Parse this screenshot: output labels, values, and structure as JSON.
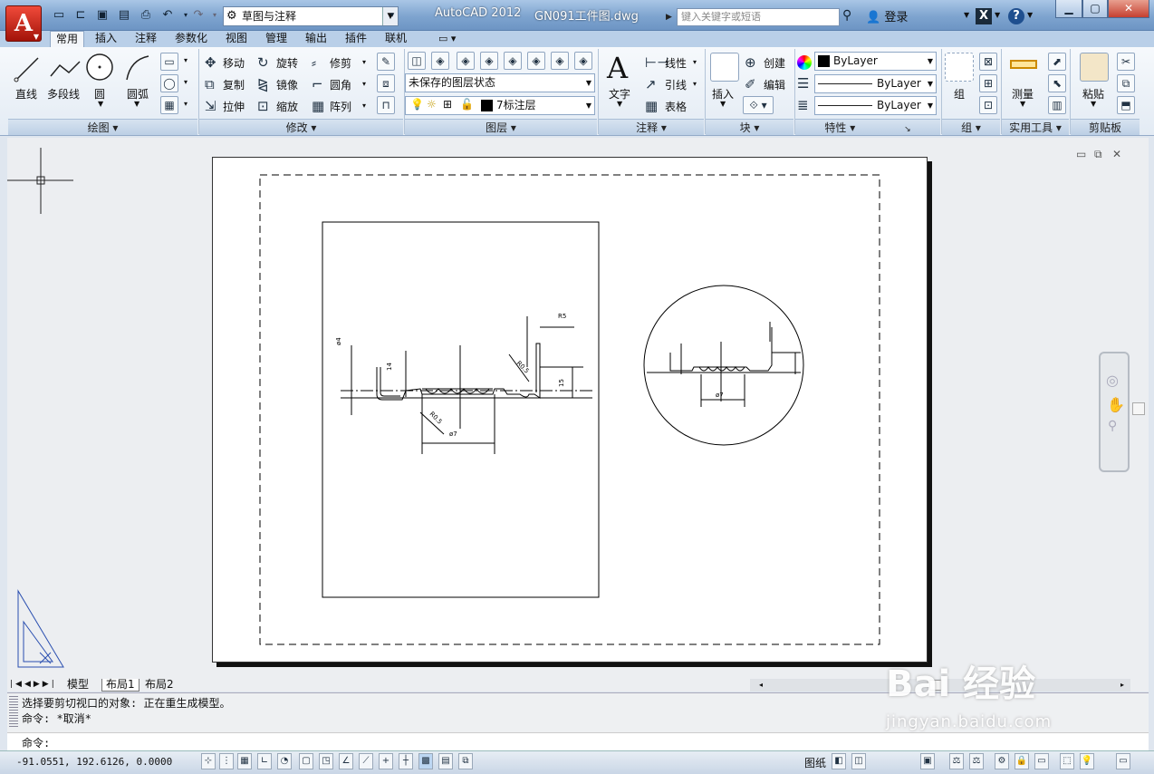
{
  "app": {
    "title": "AutoCAD 2012",
    "document": "GN091工件图.dwg",
    "logo_letter": "A"
  },
  "quick_access": {
    "workspace": "草图与注释"
  },
  "search": {
    "placeholder": "键入关键字或短语"
  },
  "user": {
    "login": "登录"
  },
  "tabs": [
    "常用",
    "插入",
    "注释",
    "参数化",
    "视图",
    "管理",
    "输出",
    "插件",
    "联机"
  ],
  "active_tab": "常用",
  "panels": {
    "draw": {
      "title": "绘图",
      "tools": [
        "直线",
        "多段线",
        "圆",
        "圆弧"
      ]
    },
    "modify": {
      "title": "修改",
      "tools": [
        "移动",
        "旋转",
        "修剪",
        "复制",
        "镜像",
        "圆角",
        "拉伸",
        "缩放",
        "阵列"
      ]
    },
    "layers": {
      "title": "图层",
      "state": "未保存的图层状态",
      "current": "7标注层"
    },
    "annotation": {
      "title": "注释",
      "big": "文字",
      "tools": [
        "线性",
        "引线",
        "表格"
      ]
    },
    "block": {
      "title": "块",
      "big": "插入",
      "tools": [
        "创建",
        "编辑"
      ]
    },
    "properties": {
      "title": "特性",
      "color": "ByLayer",
      "linetype": "ByLayer",
      "lineweight": "ByLayer"
    },
    "groups": {
      "title": "组",
      "big": "组"
    },
    "utilities": {
      "title": "实用工具",
      "big": "测量"
    },
    "clipboard": {
      "title": "剪贴板",
      "big": "粘贴"
    }
  },
  "drawing_labels": {
    "left": [
      "R5",
      "R0.5",
      "R0.5",
      "14",
      "15",
      "ø4",
      "ø7"
    ],
    "right": [
      "ø7"
    ]
  },
  "layout_tabs": [
    "模型",
    "布局1",
    "布局2"
  ],
  "active_layout": "布局1",
  "command": {
    "history": [
      "选择要剪切视口的对象: 正在重生成模型。",
      "命令: *取消*"
    ],
    "prompt": "命令:"
  },
  "status": {
    "coordinates": "-91.0551, 192.6126, 0.0000",
    "paper_label": "图纸"
  },
  "watermark": {
    "brand": "Bai 经验",
    "url": "jingyan.baidu.com"
  },
  "colors": {
    "accent_red": "#c0281b",
    "ribbon_bg": "#e9eff6",
    "titlebar": "#7ea4cf"
  }
}
